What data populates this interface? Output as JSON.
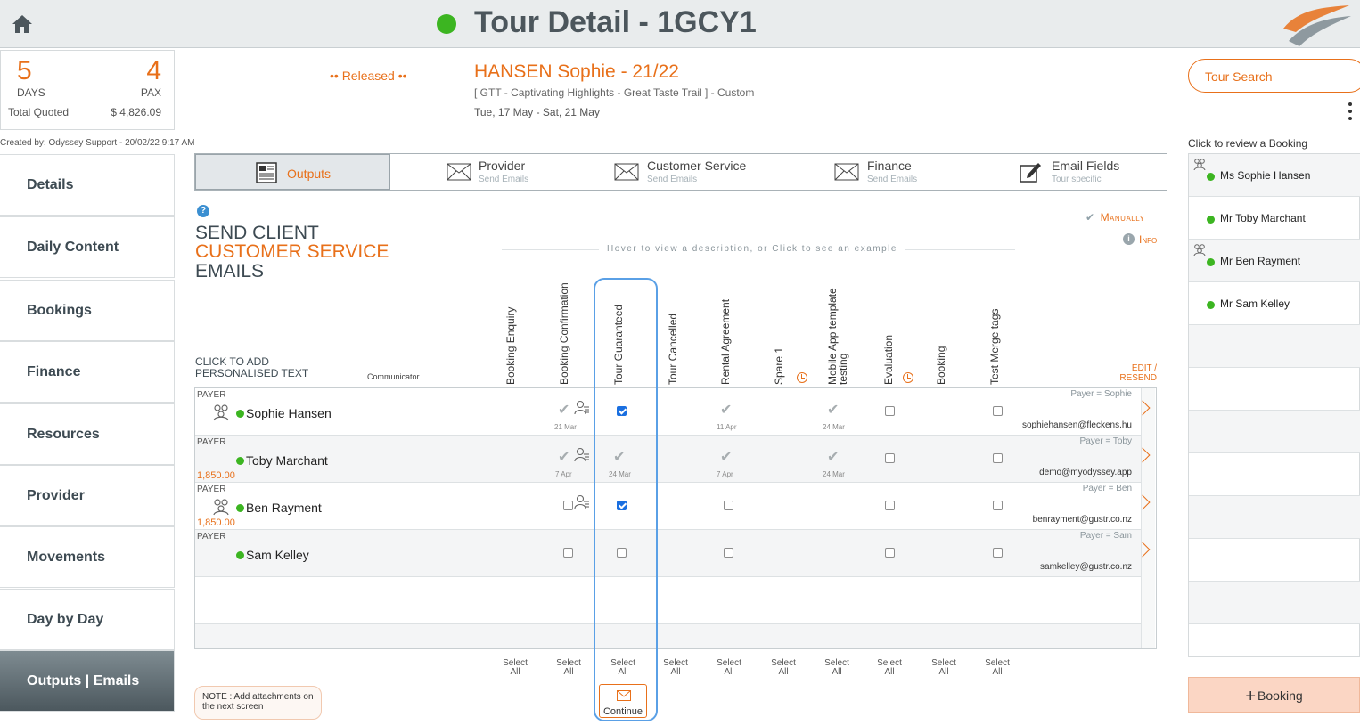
{
  "header": {
    "title": "Tour Detail - 1GCY1",
    "status_color": "#3cb521"
  },
  "stats": {
    "days_value": "5",
    "days_label": "DAYS",
    "pax_value": "4",
    "pax_label": "PAX",
    "total_label": "Total Quoted",
    "total_value": "$ 4,826.09"
  },
  "created_by": "Created by: Odyssey Support - 20/02/22 9:17 AM",
  "booking": {
    "status": "•• Released ••",
    "name": "HANSEN Sophie - 21/22",
    "trip": "[ GTT - Captivating Highlights - Great Taste Trail ] - Custom",
    "dates": "Tue, 17 May  - Sat, 21 May"
  },
  "sidebar": {
    "items": [
      {
        "label": "Details"
      },
      {
        "label": "Daily Content"
      },
      {
        "label": "Bookings"
      },
      {
        "label": "Finance"
      },
      {
        "label": "Resources"
      },
      {
        "label": "Provider"
      },
      {
        "label": "Movements"
      },
      {
        "label": "Day by Day"
      },
      {
        "label": "Outputs | Emails"
      }
    ]
  },
  "tabs": [
    {
      "label": "Outputs",
      "sub": "",
      "icon": "document-icon"
    },
    {
      "label": "Provider",
      "sub": "Send Emails",
      "icon": "envelope-icon"
    },
    {
      "label": "Customer Service",
      "sub": "Send Emails",
      "icon": "envelope-icon"
    },
    {
      "label": "Finance",
      "sub": "Send Emails",
      "icon": "envelope-icon"
    },
    {
      "label": "Email Fields",
      "sub": "Tour specific",
      "icon": "edit-icon"
    }
  ],
  "section": {
    "line1": "SEND CLIENT",
    "line2": "CUSTOMER SERVICE",
    "line3": "EMAILS",
    "manually": "Manually",
    "info": "Info",
    "hover_hint": "Hover to view a description, or Click to see an example",
    "click_add_1": "CLICK TO ADD",
    "click_add_2": "PERSONALISED TEXT",
    "communicator": "Communicator",
    "edit_resend_1": "EDIT /",
    "edit_resend_2": "RESEND"
  },
  "columns": [
    "Booking Enquiry",
    "Booking Confirmation",
    "Tour Guaranteed",
    "Tour Cancelled",
    "Rental Agreement",
    "Spare 1",
    "Mobile App template testing",
    "Evaluation",
    "Booking",
    "Test Merge tags"
  ],
  "rows": [
    {
      "payer_label": "PAYER",
      "name": "Sophie Hansen",
      "amount": "",
      "payer_right": "Payer =  Sophie",
      "email": "sophiehansen@fleckens.hu",
      "dates": {
        "confirmation": "21 Mar",
        "rental": "11 Apr",
        "mobile": "24 Mar"
      }
    },
    {
      "payer_label": "PAYER",
      "name": "Toby Marchant",
      "amount": "1,850.00",
      "payer_right": "Payer =  Toby",
      "email": "demo@myodyssey.app",
      "dates": {
        "confirmation": "7 Apr",
        "guaranteed": "24 Mar",
        "rental": "7 Apr",
        "mobile": "24 Mar"
      }
    },
    {
      "payer_label": "PAYER",
      "name": "Ben Rayment",
      "amount": "1,850.00",
      "payer_right": "Payer =  Ben",
      "email": "benrayment@gustr.co.nz"
    },
    {
      "payer_label": "PAYER",
      "name": "Sam Kelley",
      "amount": "",
      "payer_right": "Payer =  Sam",
      "email": "samkelley@gustr.co.nz"
    }
  ],
  "select_all": {
    "line1": "Select",
    "line2": "All"
  },
  "note": "NOTE : Add attachments on the next screen",
  "continue_label": "Continue",
  "right": {
    "tour_search": "Tour Search",
    "review_label": "Click to review a Booking",
    "bookings": [
      "Ms Sophie Hansen",
      "Mr Toby Marchant",
      "Mr Ben Rayment",
      "Mr Sam Kelley"
    ],
    "add_booking": "Booking"
  },
  "colors": {
    "accent": "#e8701a",
    "online": "#3cb521",
    "highlight": "#5aa0e6"
  }
}
